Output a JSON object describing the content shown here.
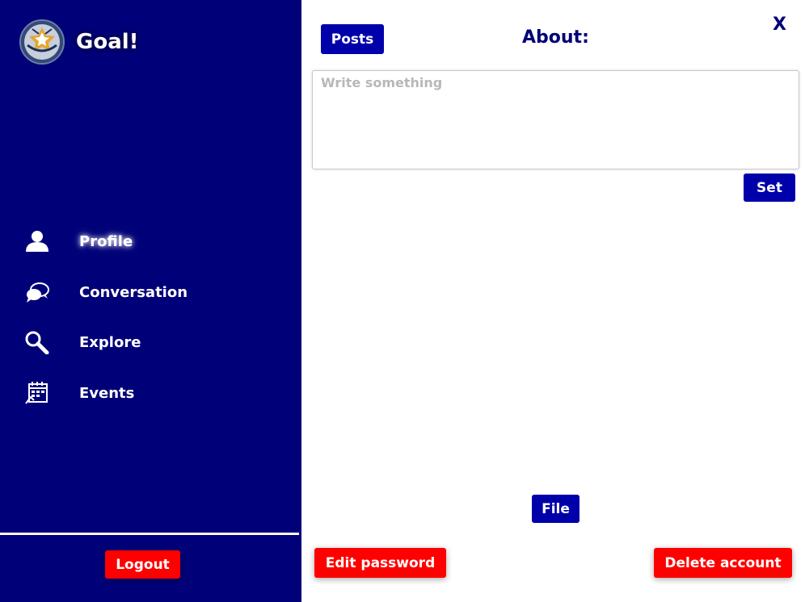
{
  "brand": {
    "name": "Goal!",
    "logo_icon": "soccer-ball-icon"
  },
  "sidebar": {
    "items": [
      {
        "label": "Profile",
        "icon": "user-icon",
        "active": true
      },
      {
        "label": "Conversation",
        "icon": "chat-bubbles-icon",
        "active": false
      },
      {
        "label": "Explore",
        "icon": "magnifier-icon",
        "active": false
      },
      {
        "label": "Events",
        "icon": "calendar-icon",
        "active": false
      }
    ],
    "logout_label": "Logout"
  },
  "main": {
    "posts_label": "Posts",
    "about_title": "About:",
    "close_label": "X",
    "about_input": {
      "placeholder": "Write something",
      "value": ""
    },
    "set_label": "Set",
    "file_label": "File",
    "edit_password_label": "Edit password",
    "delete_account_label": "Delete account"
  },
  "colors": {
    "sidebar_bg": "#000078",
    "primary_button": "#0000aa",
    "danger_button": "#ff0000",
    "title_text": "#000078"
  }
}
